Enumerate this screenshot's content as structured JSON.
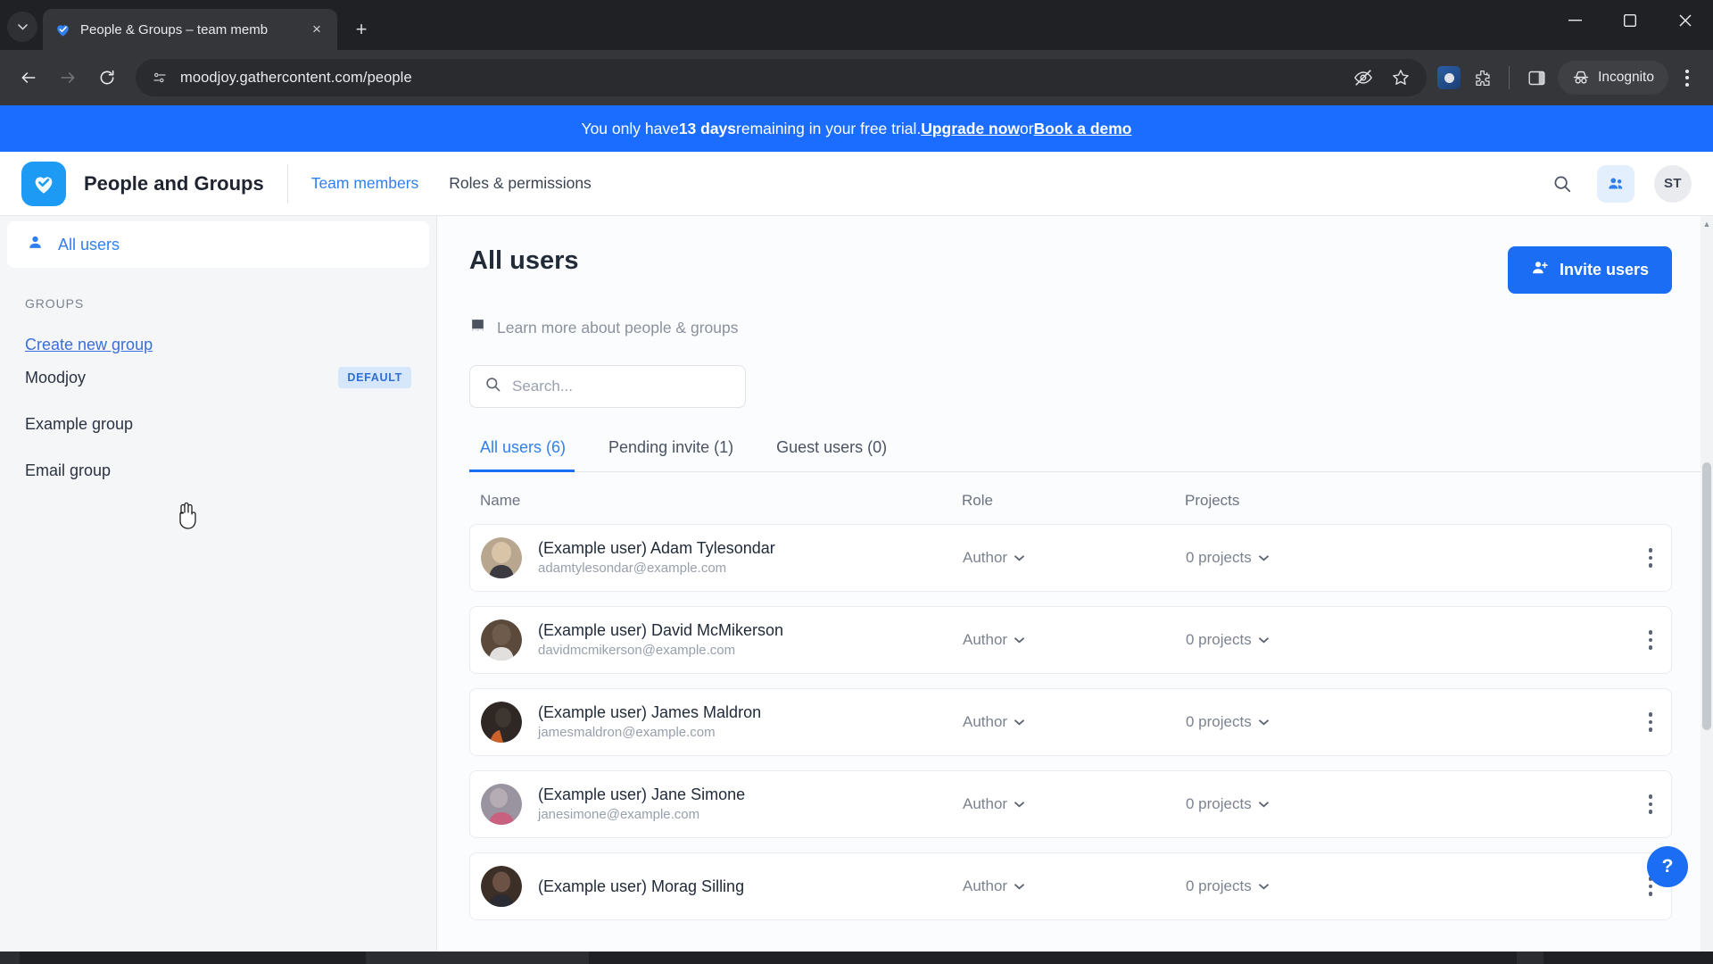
{
  "browser": {
    "tab": {
      "title": "People & Groups – team memb",
      "favicon": "gathercontent-heart-icon",
      "close": "×"
    },
    "new_tab_label": "+",
    "window_controls": {
      "minimize": "—",
      "maximize": "▢",
      "close": "✕"
    },
    "toolbar": {
      "back": "←",
      "forward": "→",
      "reload": "⟳",
      "url": "moodjoy.gathercontent.com/people",
      "site_settings_icon": "page-info-icon",
      "hide_password_icon": "eye-slash-icon",
      "bookmark_icon": "star-icon",
      "extension_icon": "extension-puzzle-icon",
      "split_view_icon": "side-panel-icon",
      "incognito_label": "Incognito",
      "menu_icon": "three-dots-vertical-icon"
    }
  },
  "trial_banner": {
    "prefix": "You only have ",
    "days": "13 days",
    "middle": " remaining in your free trial. ",
    "upgrade_link": "Upgrade now",
    "or": " or ",
    "demo_link": "Book a demo"
  },
  "app_header": {
    "brand": "People and Groups",
    "logo_icon": "gathercontent-logo-icon",
    "nav": [
      {
        "label": "Team members",
        "active": true
      },
      {
        "label": "Roles & permissions",
        "active": false
      }
    ],
    "search_icon": "search-icon",
    "people_icon": "people-group-icon",
    "avatar_initials": "ST"
  },
  "sidebar": {
    "all_users": {
      "label": "All users",
      "icon": "person-icon"
    },
    "groups_label": "GROUPS",
    "create_link": "Create new group",
    "groups": [
      {
        "name": "Moodjoy",
        "badge": "DEFAULT"
      },
      {
        "name": "Example group",
        "badge": ""
      },
      {
        "name": "Email group",
        "badge": ""
      }
    ]
  },
  "main": {
    "title": "All users",
    "invite_button": "Invite users",
    "invite_icon": "add-person-icon",
    "learn_more": "Learn more about people & groups",
    "learn_icon": "book-icon",
    "search_placeholder": "Search...",
    "search_icon": "search-icon",
    "tabs": [
      {
        "label": "All users (6)",
        "active": true
      },
      {
        "label": "Pending invite (1)",
        "active": false
      },
      {
        "label": "Guest users (0)",
        "active": false
      }
    ],
    "columns": {
      "name": "Name",
      "role": "Role",
      "projects": "Projects"
    },
    "users": [
      {
        "name": "(Example user) Adam Tylesondar",
        "email": "adamtylesondar@example.com",
        "role": "Author",
        "projects": "0 projects",
        "avatar_color": "#9c8a77"
      },
      {
        "name": "(Example user) David McMikerson",
        "email": "davidmcmikerson@example.com",
        "role": "Author",
        "projects": "0 projects",
        "avatar_color": "#6e5b4b"
      },
      {
        "name": "(Example user) James Maldron",
        "email": "jamesmaldron@example.com",
        "role": "Author",
        "projects": "0 projects",
        "avatar_color": "#3e3630"
      },
      {
        "name": "(Example user) Jane Simone",
        "email": "janesimone@example.com",
        "role": "Author",
        "projects": "0 projects",
        "avatar_color": "#8f8b95"
      },
      {
        "name": "(Example user) Morag Silling",
        "email": "",
        "role": "Author",
        "projects": "0 projects",
        "avatar_color": "#4a3a30"
      }
    ],
    "help_button": "?"
  },
  "colors": {
    "accent": "#1b6ef3",
    "banner": "#1a6dff",
    "brand_logo": "#1d9bf4",
    "link": "#3b6fd6",
    "badge_bg": "#d6e6fb",
    "badge_text": "#2f6fd0"
  }
}
